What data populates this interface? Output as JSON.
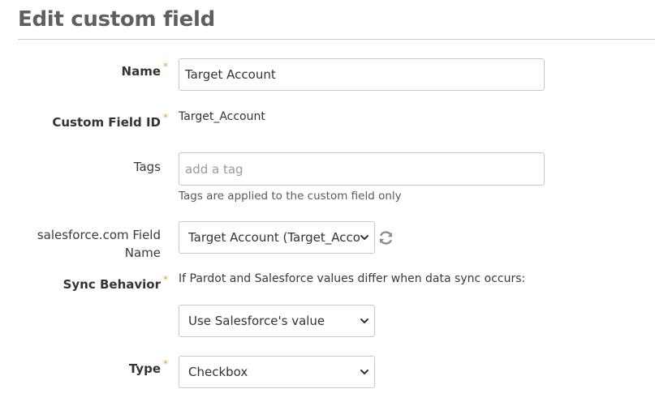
{
  "page": {
    "title": "Edit custom field"
  },
  "form": {
    "name": {
      "label": "Name",
      "required_mark": "*",
      "value": "Target Account"
    },
    "custom_field_id": {
      "label": "Custom Field ID",
      "required_mark": "*",
      "value": "Target_Account"
    },
    "tags": {
      "label": "Tags",
      "placeholder": "add a tag",
      "help": "Tags are applied to the custom field only"
    },
    "salesforce_field": {
      "label_line1": "salesforce.com Field",
      "label_line2": "Name",
      "selected": "Target Account (Target_Acco",
      "refresh_icon": "refresh-icon"
    },
    "sync_behavior": {
      "label": "Sync Behavior",
      "required_mark": "*",
      "description": "If Pardot and Salesforce values differ when data sync occurs:",
      "selected": "Use Salesforce's value"
    },
    "type": {
      "label": "Type",
      "required_mark": "*",
      "selected": "Checkbox"
    }
  },
  "colors": {
    "required": "#e8a33d",
    "title": "#5f5f5f",
    "border": "#c8c8c8",
    "icon": "#8a8a8a"
  }
}
